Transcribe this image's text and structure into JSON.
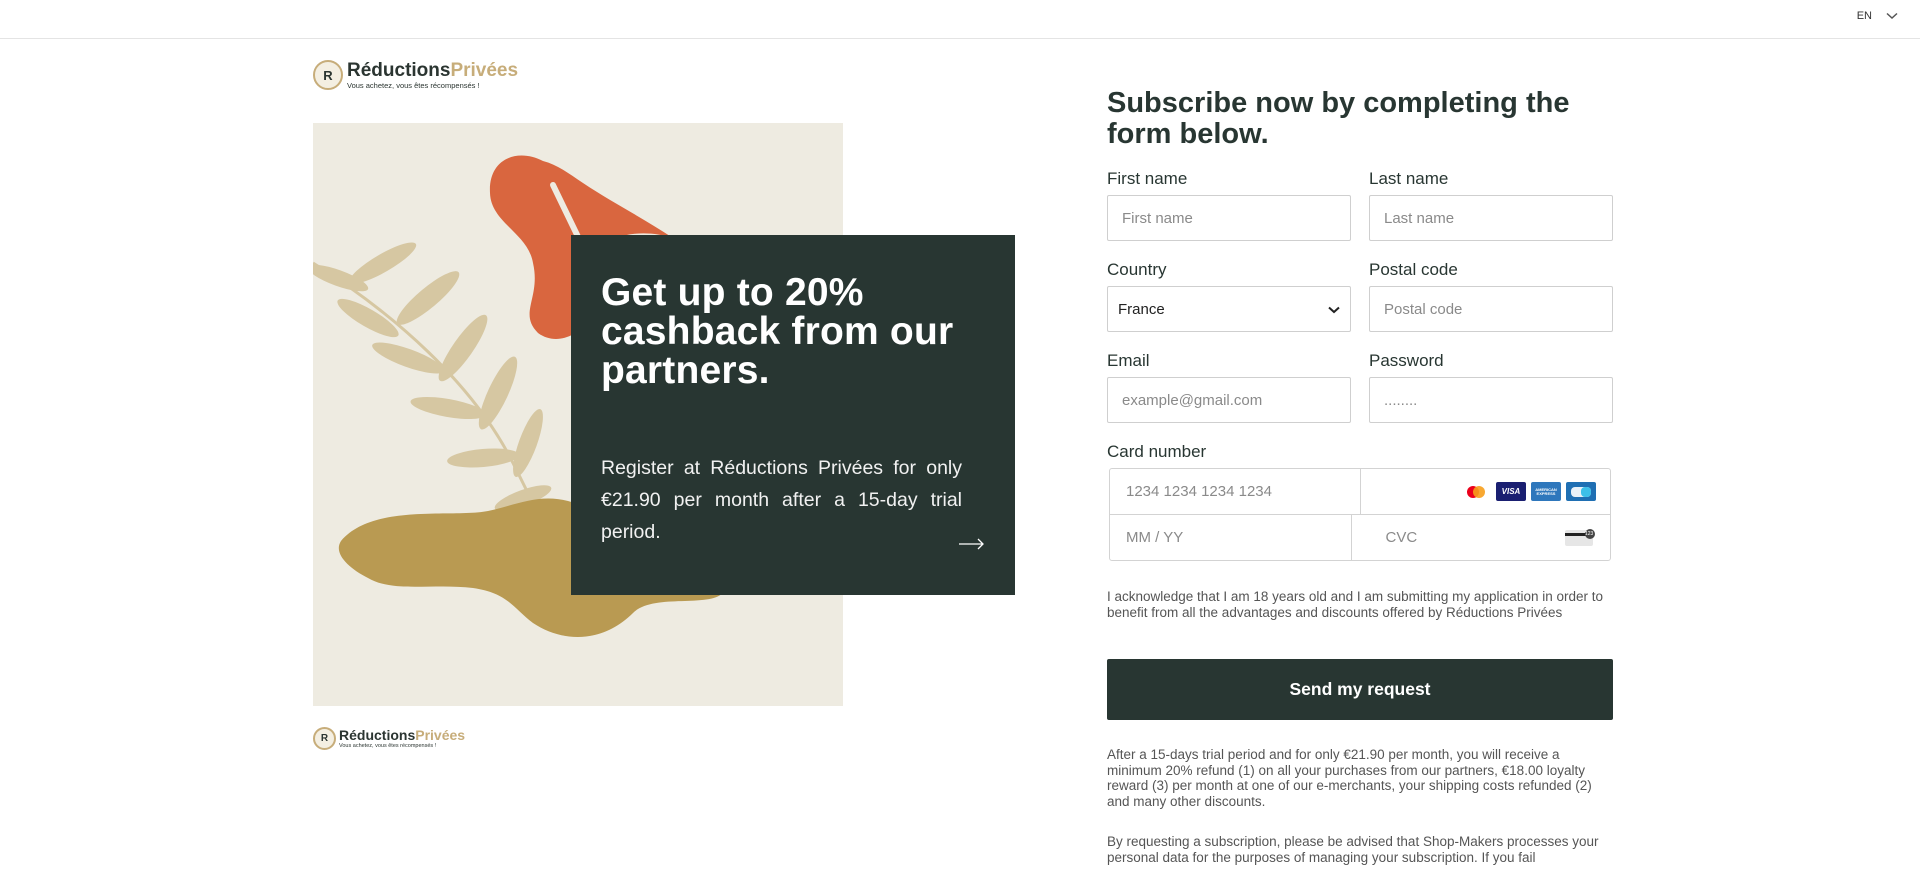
{
  "header": {
    "language": "EN"
  },
  "brand": {
    "name_part1": "Réductions",
    "name_part2": "Privées",
    "tagline": "Vous achetez, vous êtes récompensés !",
    "mark_letter": "R"
  },
  "promo": {
    "title": "Get up to 20% cashback from our partners.",
    "body": "Register at Réductions Privées for only €21.90 per month after a 15-day trial period."
  },
  "form": {
    "title": "Subscribe now by completing the form below.",
    "first_name": {
      "label": "First name",
      "placeholder": "First name"
    },
    "last_name": {
      "label": "Last name",
      "placeholder": "Last name"
    },
    "country": {
      "label": "Country",
      "value": "France"
    },
    "postal_code": {
      "label": "Postal code",
      "placeholder": "Postal code"
    },
    "email": {
      "label": "Email",
      "placeholder": "example@gmail.com"
    },
    "password": {
      "label": "Password",
      "placeholder": "........"
    },
    "card": {
      "label": "Card number",
      "number_placeholder": "1234 1234 1234 1234",
      "expiry_placeholder": "MM / YY",
      "cvc_placeholder": "CVC",
      "brands": [
        "mastercard-icon",
        "visa-icon",
        "amex-icon",
        "cartes-bancaires-icon"
      ],
      "visa_text": "VISA",
      "amex_text": "AMERICAN EXPRESS",
      "cvc_badge": "123"
    },
    "acknowledgement": "I acknowledge that I am 18 years old and I am submitting my application in order to benefit from all the advantages and discounts offered by Réductions Privées",
    "submit_label": "Send my request",
    "terms_note": "After a 15-days trial period and for only €21.90 per month, you will receive a minimum 20% refund (1) on all your purchases from our partners, €18.00 loyalty reward (3) per month at one of our e-merchants, your shipping costs refunded (2) and many other discounts.",
    "privacy_note": "By requesting a subscription, please be advised that Shop-Makers processes your personal data for the purposes of managing your subscription. If you fail"
  },
  "colors": {
    "primary": "#283632",
    "gold": "#c7ad7a",
    "art_background": "#eeebe1",
    "leaf_orange": "#d9663f",
    "leaf_olive": "#b99a52",
    "leaf_sage": "#d6c7a2"
  }
}
